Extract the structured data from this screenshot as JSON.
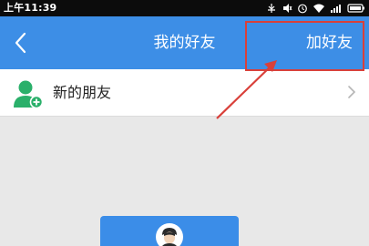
{
  "status_bar": {
    "time": "上午11:39",
    "icons": [
      "usb-icon",
      "mute-icon",
      "alarm-icon",
      "wifi-icon",
      "signal-icon",
      "battery-icon"
    ]
  },
  "nav_bar": {
    "title": "我的好友",
    "action_label": "加好友",
    "background_color": "#3d8ee6"
  },
  "list": {
    "items": [
      {
        "label": "新的朋友",
        "icon": "add-user-icon"
      }
    ]
  },
  "annotation": {
    "color": "#d9403a"
  }
}
